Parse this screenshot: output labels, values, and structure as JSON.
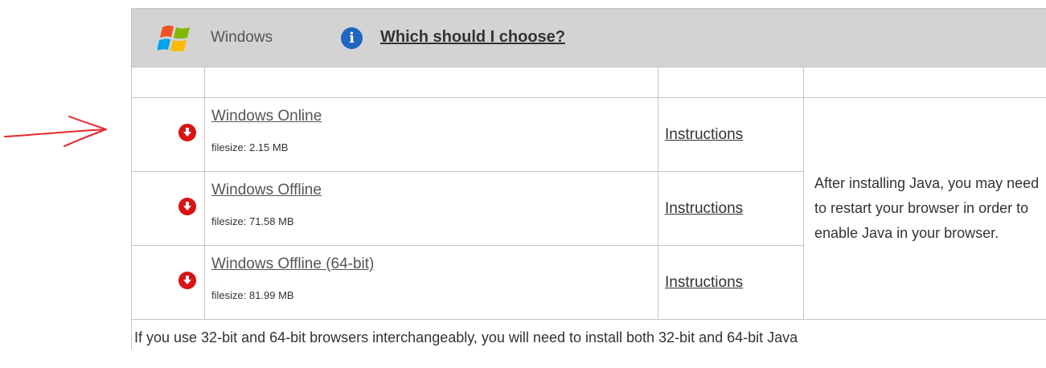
{
  "header": {
    "os_label": "Windows",
    "help_link": "Which should I choose?",
    "info_icon_text": "i"
  },
  "downloads": [
    {
      "name": "Windows Online",
      "filesize": "filesize: 2.15 MB",
      "instructions": "Instructions"
    },
    {
      "name": "Windows Offline",
      "filesize": "filesize: 71.58 MB",
      "instructions": "Instructions"
    },
    {
      "name": "Windows Offline (64-bit)",
      "filesize": "filesize: 81.99 MB",
      "instructions": "Instructions"
    }
  ],
  "note": "After installing Java, you may need to restart your browser in order to enable Java in your browser.",
  "footer": "If you use 32-bit and 64-bit browsers interchangeably, you will need to install both 32-bit and 64-bit Java",
  "colors": {
    "header_bg": "#d3d3d3",
    "download_icon": "#dd1111",
    "info_icon": "#1f66c2",
    "annotation_arrow": "#e8272b"
  }
}
